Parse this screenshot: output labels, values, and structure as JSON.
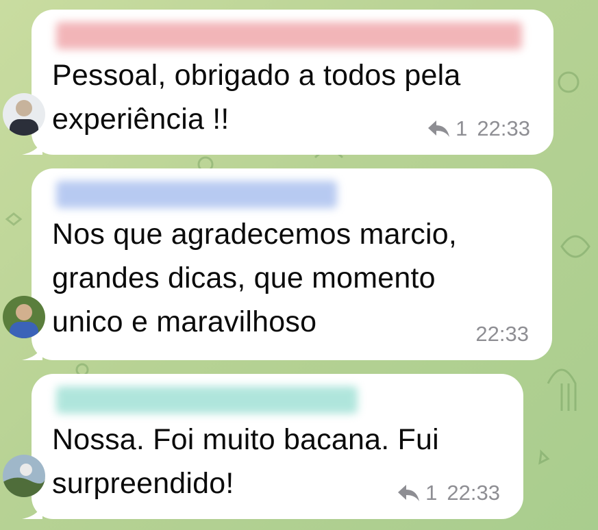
{
  "colors": {
    "background": "#b7d294",
    "bubble": "#ffffff",
    "meta_text": "#8e8e93",
    "sender_1": "#e8797f",
    "sender_2": "#7e9fe6",
    "sender_3": "#6fd1c0"
  },
  "messages": [
    {
      "text": "Pessoal, obrigado a todos pela\nexperiência !!",
      "reply_count": "1",
      "time": "22:33"
    },
    {
      "text": "Nos que agradecemos marcio,\ngrandes dicas, que momento\nunico e maravilhoso",
      "time": "22:33"
    },
    {
      "text": "Nossa. Foi muito bacana. Fui\nsurpreendido!",
      "reply_count": "1",
      "time": "22:33"
    }
  ],
  "icons": [
    "reply-arrow-icon",
    "avatar"
  ]
}
